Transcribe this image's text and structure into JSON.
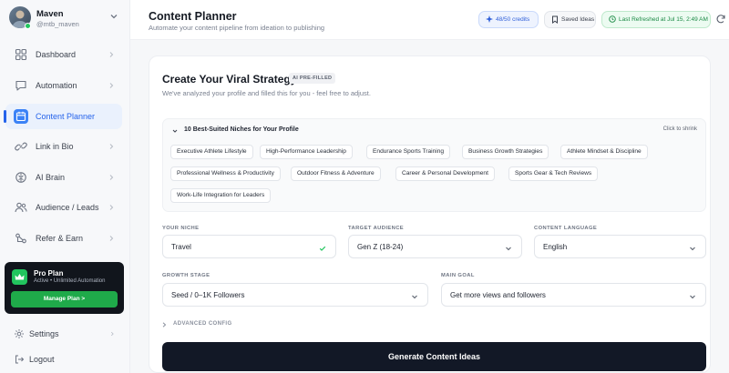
{
  "profile": {
    "name": "Maven",
    "handle": "@mtb_maven"
  },
  "nav": [
    {
      "label": "Dashboard",
      "icon": "grid-icon"
    },
    {
      "label": "Automation",
      "icon": "chat-icon"
    },
    {
      "label": "Content Planner",
      "icon": "calendar-icon",
      "active": true
    },
    {
      "label": "Link in Bio",
      "icon": "link-icon"
    },
    {
      "label": "AI Brain",
      "icon": "brain-icon"
    },
    {
      "label": "Audience / Leads",
      "icon": "users-icon"
    },
    {
      "label": "Refer & Earn",
      "icon": "share-icon"
    }
  ],
  "pro": {
    "title": "Pro Plan",
    "subtitle": "Active • Unlimited Automation",
    "button": "Manage Plan >"
  },
  "bottom": {
    "settings": "Settings",
    "logout": "Logout"
  },
  "header": {
    "title": "Content Planner",
    "subtitle": "Automate your content pipeline from ideation to publishing",
    "credits": "48/50 credits",
    "saved": "Saved Ideas",
    "refreshed": "Last Refreshed at Jul 15, 2:49 AM"
  },
  "card": {
    "title": "Create Your Viral Strategy",
    "badge": "AI PRE-FILLED",
    "subtitle": "We've analyzed your profile and filled this for you - feel free to adjust.",
    "niches_heading": "10 Best-Suited Niches for Your Profile",
    "niches_toggle": "Click to shrink",
    "niches": [
      "Executive Athlete Lifestyle",
      "High-Performance Leadership",
      "Endurance Sports Training",
      "Business Growth Strategies",
      "Athlete Mindset & Discipline",
      "Professional Wellness & Productivity",
      "Outdoor Fitness & Adventure",
      "Career & Personal Development",
      "Sports Gear & Tech Reviews",
      "Work-Life Integration for Leaders"
    ],
    "fields": {
      "niche_label": "YOUR NICHE",
      "niche_value": "Travel",
      "audience_label": "TARGET AUDIENCE",
      "audience_value": "Gen Z (18-24)",
      "language_label": "CONTENT LANGUAGE",
      "language_value": "English",
      "stage_label": "GROWTH STAGE",
      "stage_value": "Seed / 0–1K Followers",
      "goal_label": "MAIN GOAL",
      "goal_value": "Get more views and followers"
    },
    "advanced": "ADVANCED CONFIG",
    "generate": "Generate Content Ideas"
  },
  "colors": {
    "accent": "#2563eb",
    "success": "#22c55e",
    "dark": "#121826"
  }
}
